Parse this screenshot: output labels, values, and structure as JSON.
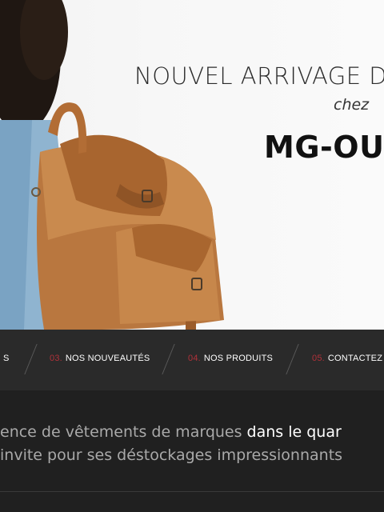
{
  "hero": {
    "headline": "NOUVEL ARRIVAGE DE",
    "subline": "chez",
    "brand": "MG-OU"
  },
  "nav": {
    "items": [
      {
        "number": "",
        "label": "S"
      },
      {
        "number": "03.",
        "label": "NOS NOUVEAUTÉS"
      },
      {
        "number": "04.",
        "label": "NOS PRODUITS"
      },
      {
        "number": "05.",
        "label": "CONTACTEZ N"
      }
    ]
  },
  "intro": {
    "line1_before": "ence de vêtements de marques ",
    "line1_highlight": "dans le quar",
    "line2": "invite pour ses déstockages impressionnants"
  },
  "colors": {
    "nav_background": "#2a2a2a",
    "nav_number_accent": "#b0313a",
    "content_background": "#202020",
    "text_muted": "#a9a9a9"
  }
}
